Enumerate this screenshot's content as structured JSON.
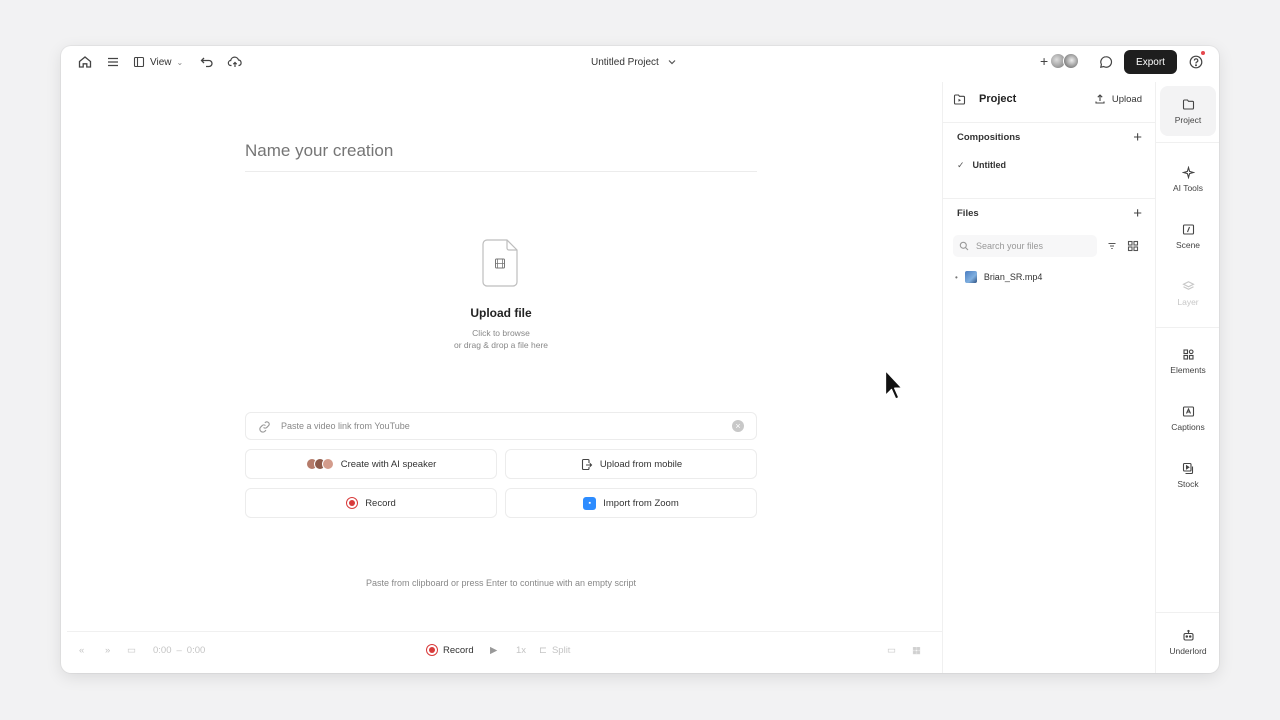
{
  "topbar": {
    "view_label": "View",
    "project_title": "Untitled Project",
    "export_label": "Export"
  },
  "main": {
    "name_placeholder": "Name your creation",
    "upload_title": "Upload file",
    "upload_sub1": "Click to browse",
    "upload_sub2": "or drag & drop a file here",
    "youtube_placeholder": "Paste a video link from YouTube",
    "create_ai_speaker": "Create with AI speaker",
    "upload_mobile": "Upload from mobile",
    "record": "Record",
    "import_zoom": "Import from Zoom",
    "hint": "Paste from clipboard or press Enter to continue with an empty script"
  },
  "bottombar": {
    "time_current": "0:00",
    "time_total": "0:00",
    "record": "Record",
    "speed": "1x",
    "split": "Split"
  },
  "panel": {
    "title": "Project",
    "upload": "Upload",
    "compositions_title": "Compositions",
    "compositions": [
      "Untitled"
    ],
    "files_title": "Files",
    "search_placeholder": "Search your files",
    "files": [
      "Brian_SR.mp4"
    ]
  },
  "rail": {
    "items": [
      "Project",
      "AI Tools",
      "Scene",
      "Layer",
      "Elements",
      "Captions",
      "Stock",
      "Underlord"
    ]
  },
  "colors": {
    "export_bg": "#1e1e1e",
    "record_red": "#d83b3b",
    "zoom_blue": "#2d8cff",
    "notification": "#e5484d"
  }
}
